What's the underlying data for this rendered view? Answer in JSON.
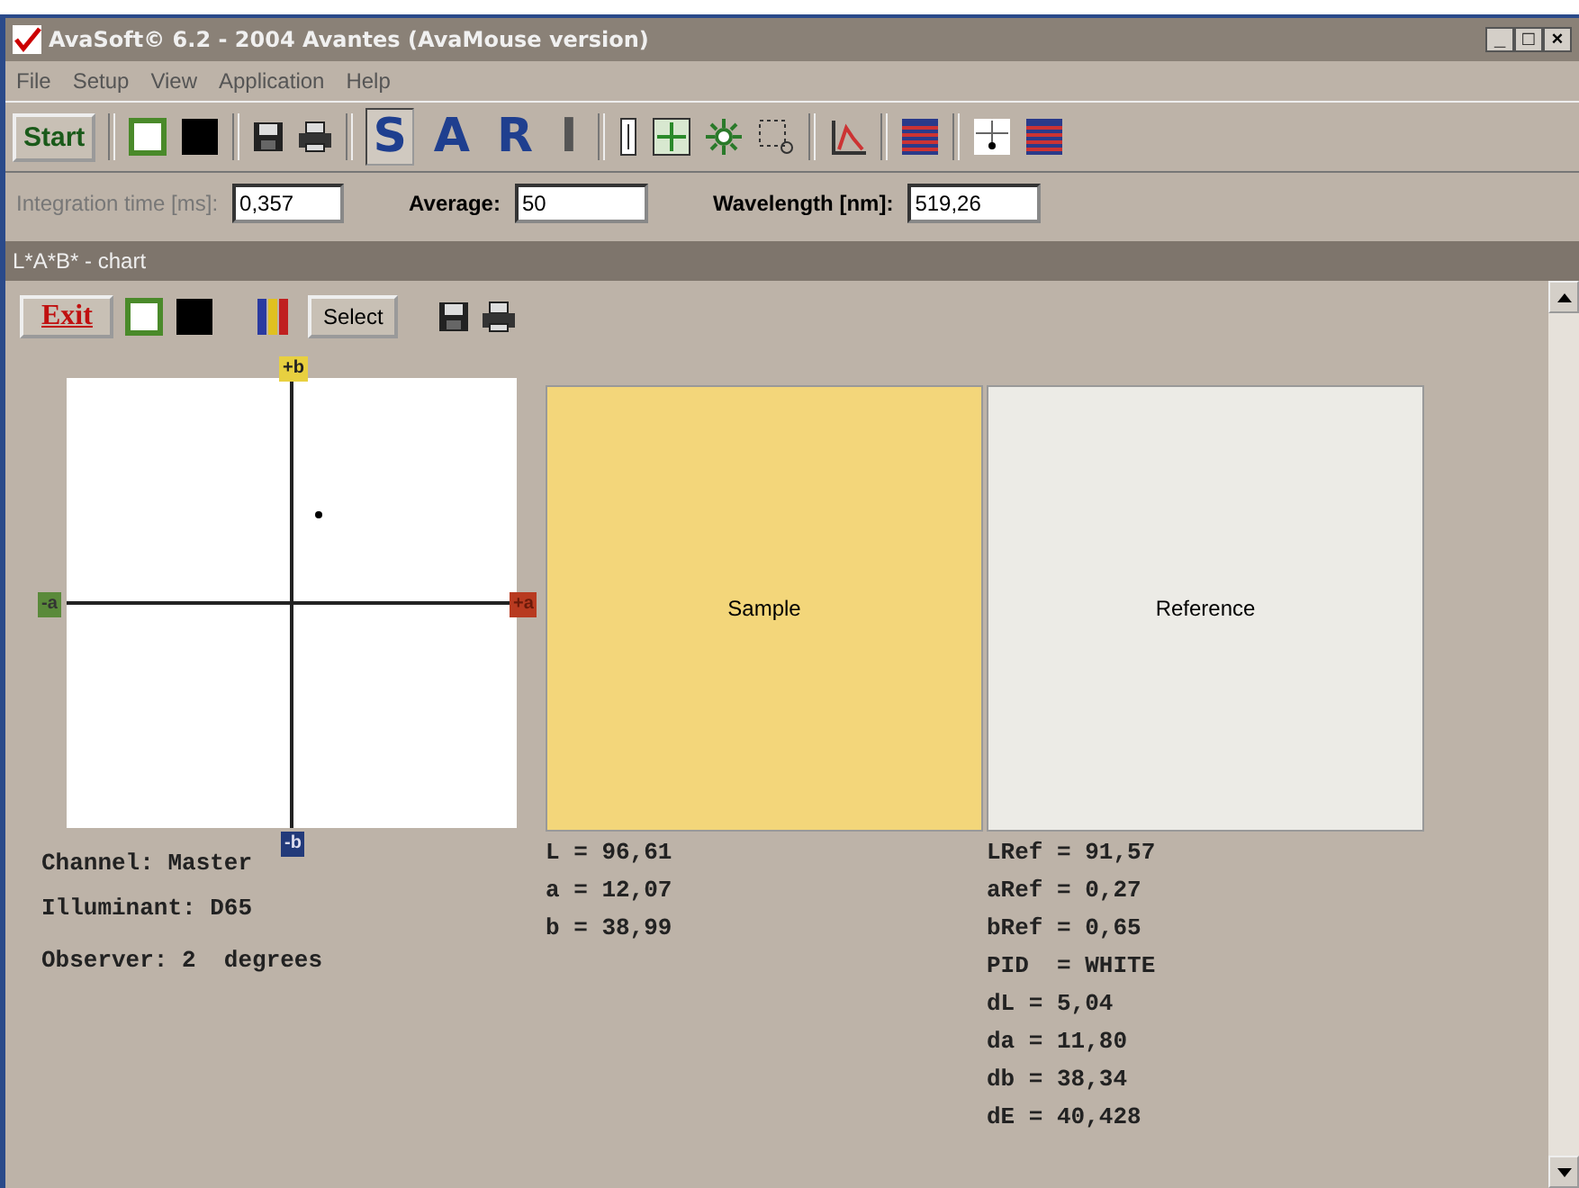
{
  "window": {
    "title": "AvaSoft© 6.2 - 2004 Avantes (AvaMouse version)",
    "controls": [
      "_",
      "□",
      "×"
    ]
  },
  "menu": [
    "File",
    "Setup",
    "View",
    "Application",
    "Help"
  ],
  "toolbar": {
    "start": "Start",
    "modes": [
      {
        "label": "S",
        "selected": true
      },
      {
        "label": "A",
        "selected": false
      },
      {
        "label": "R",
        "selected": false
      },
      {
        "label": "I",
        "selected": false
      }
    ]
  },
  "fields": [
    {
      "label": "Integration time [ms]:",
      "value": "0,357",
      "disabled": true
    },
    {
      "label": "Average:",
      "value": "50",
      "disabled": false
    },
    {
      "label": "Wavelength [nm]:",
      "value": "519,26",
      "disabled": false
    }
  ],
  "child": {
    "title": "L*A*B* - chart",
    "exit": "Exit",
    "select": "Select"
  },
  "axes": {
    "top": "+b",
    "left": "-a",
    "right": "+a",
    "bottom": "-b"
  },
  "info": [
    "Channel: Master",
    "Illuminant: D65",
    "Observer: 2  degrees"
  ],
  "sample": {
    "label": "Sample",
    "values": [
      "L = 96,61",
      "a = 12,07",
      "b = 38,99"
    ]
  },
  "reference": {
    "label": "Reference",
    "values": [
      "LRef = 91,57",
      "aRef = 0,27",
      "bRef = 0,65",
      "PID  = WHITE",
      "dL = 5,04",
      "da = 11,80",
      "db = 38,34",
      "dE = 40,428"
    ]
  }
}
